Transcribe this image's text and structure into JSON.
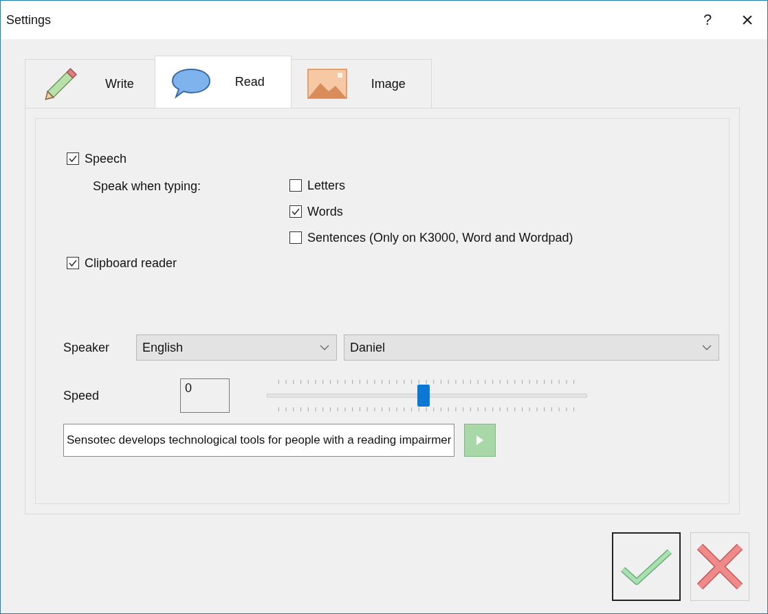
{
  "window": {
    "title": "Settings",
    "help": "?",
    "close": "×"
  },
  "tabs": [
    {
      "label": "Write",
      "selected": false
    },
    {
      "label": "Read",
      "selected": true
    },
    {
      "label": "Image",
      "selected": false
    }
  ],
  "speech": {
    "label": "Speech",
    "checked": true
  },
  "speak_when_typing": {
    "label": "Speak when typing:",
    "options": [
      {
        "label": "Letters",
        "checked": false
      },
      {
        "label": "Words",
        "checked": true
      },
      {
        "label": "Sentences (Only on K3000, Word and Wordpad)",
        "checked": false
      }
    ]
  },
  "clipboard_reader": {
    "label": "Clipboard reader",
    "checked": true
  },
  "speaker": {
    "label": "Speaker",
    "language": "English",
    "voice": "Daniel"
  },
  "speed": {
    "label": "Speed",
    "value": "0",
    "level": 0.49
  },
  "sample_text": {
    "value": "Sensotec develops technological tools for people with a reading impairmer"
  }
}
